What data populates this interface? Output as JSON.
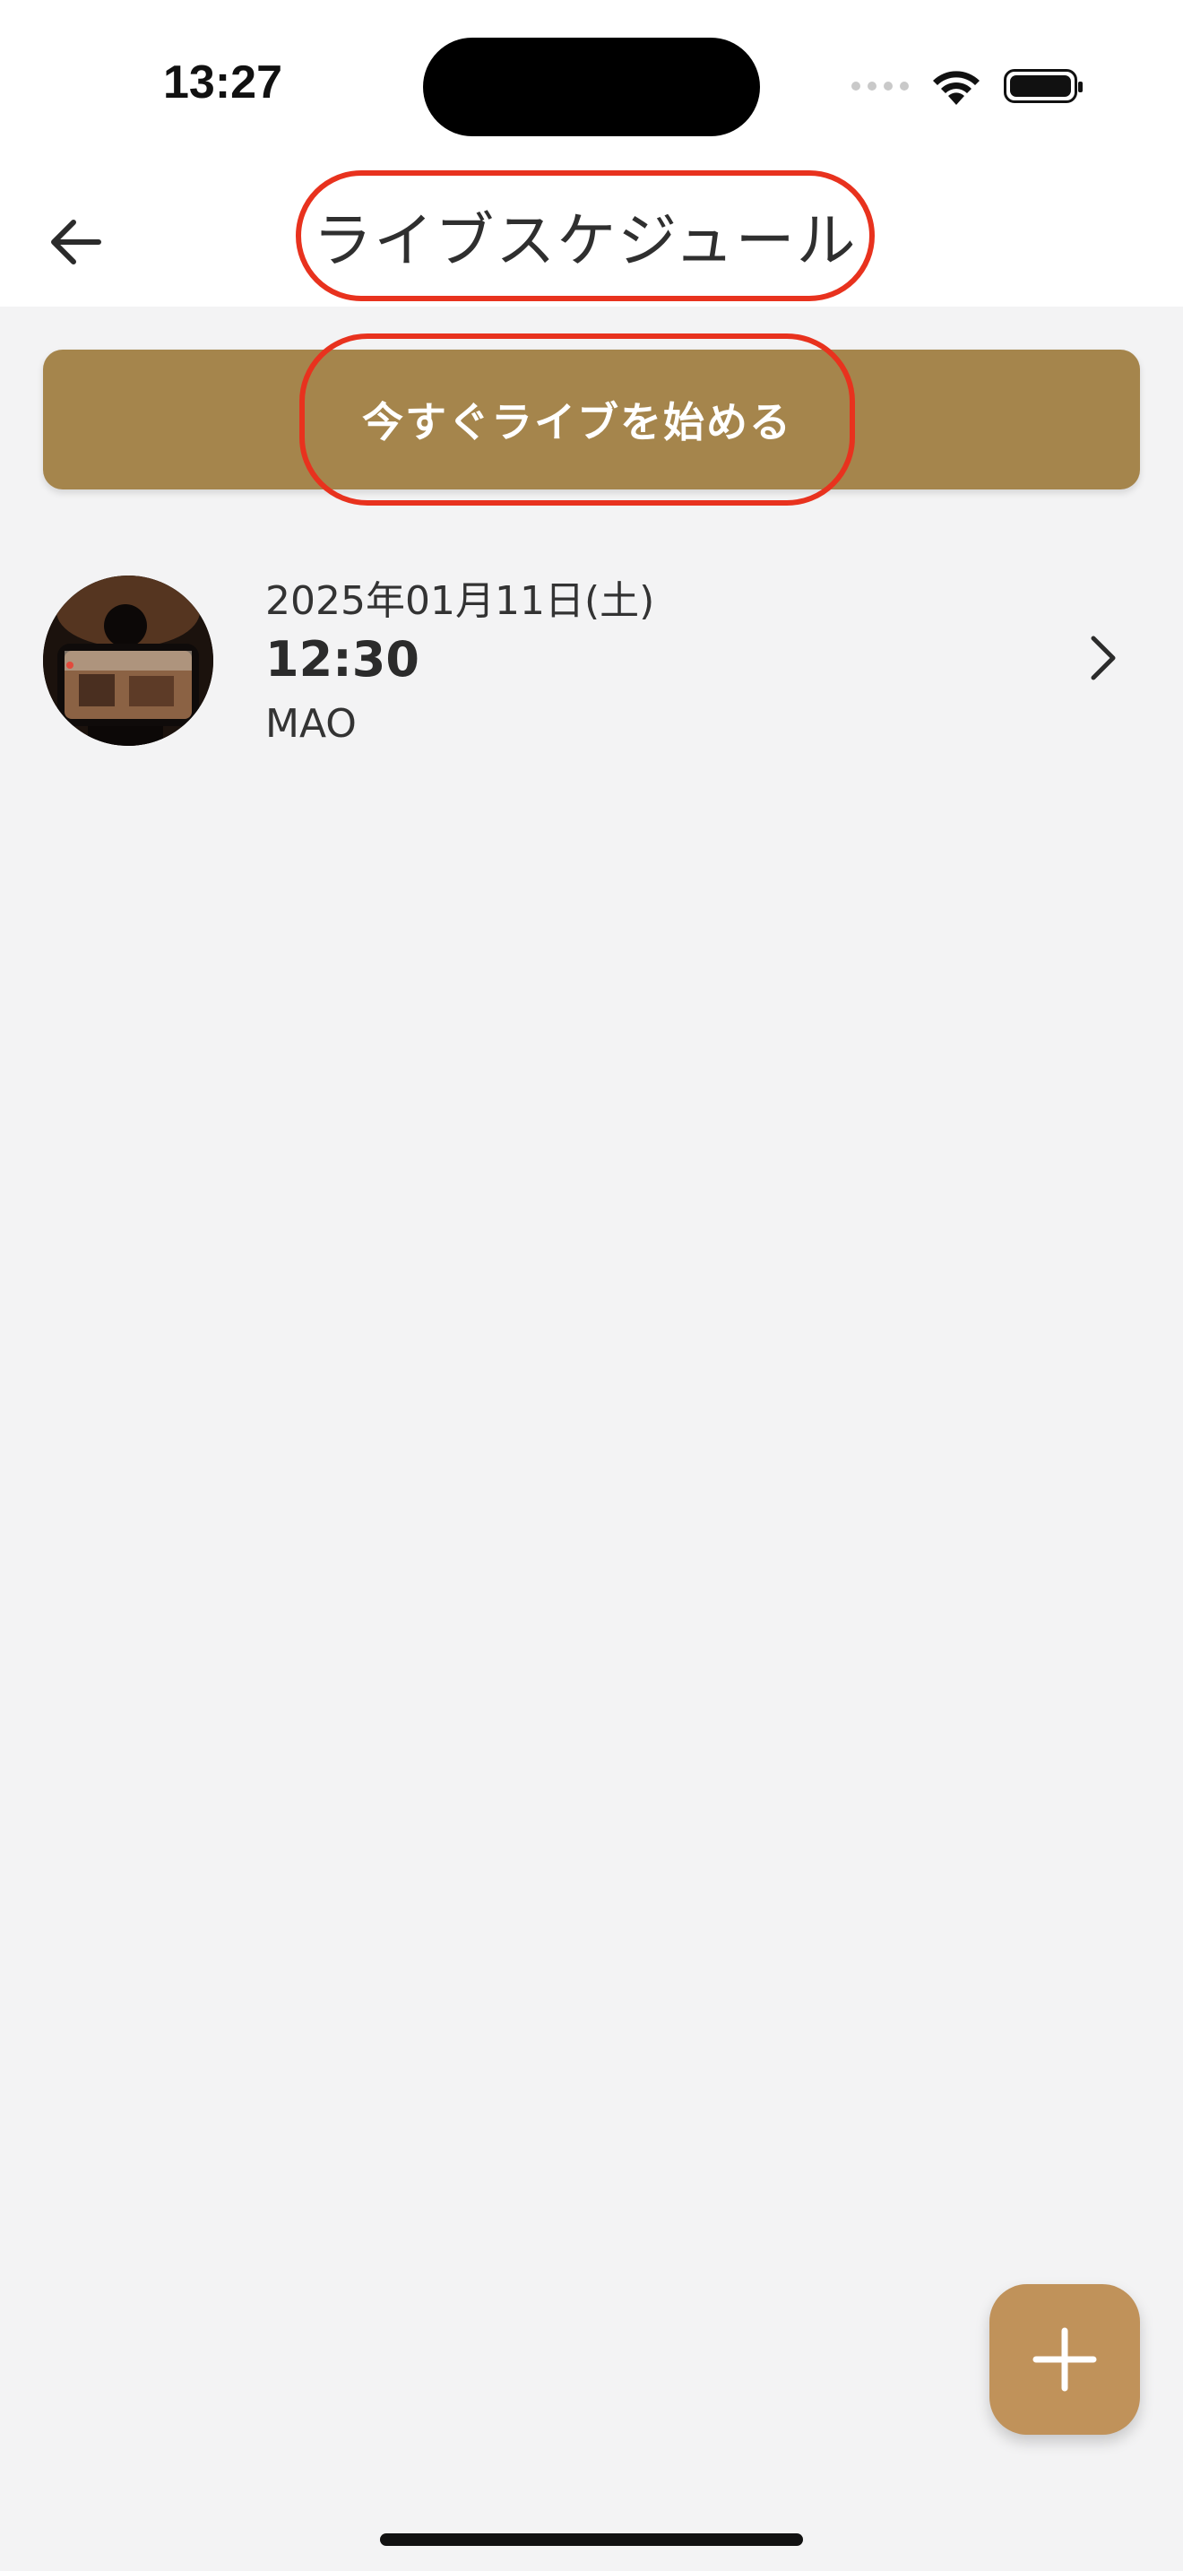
{
  "status_bar": {
    "time": "13:27"
  },
  "app_bar": {
    "title": "ライブスケジュール"
  },
  "actions": {
    "start_live_label": "今すぐライブを始める"
  },
  "schedule": [
    {
      "date": "2025年01月11日(土)",
      "time": "12:30",
      "name": "MAO"
    }
  ],
  "colors": {
    "accent_button": "#a5854c",
    "fab": "#c0925a",
    "highlight_outline": "#e8321e",
    "background": "#f3f3f4"
  },
  "icons": {
    "back": "arrow-left-icon",
    "chevron": "chevron-right-icon",
    "fab": "plus-icon"
  }
}
